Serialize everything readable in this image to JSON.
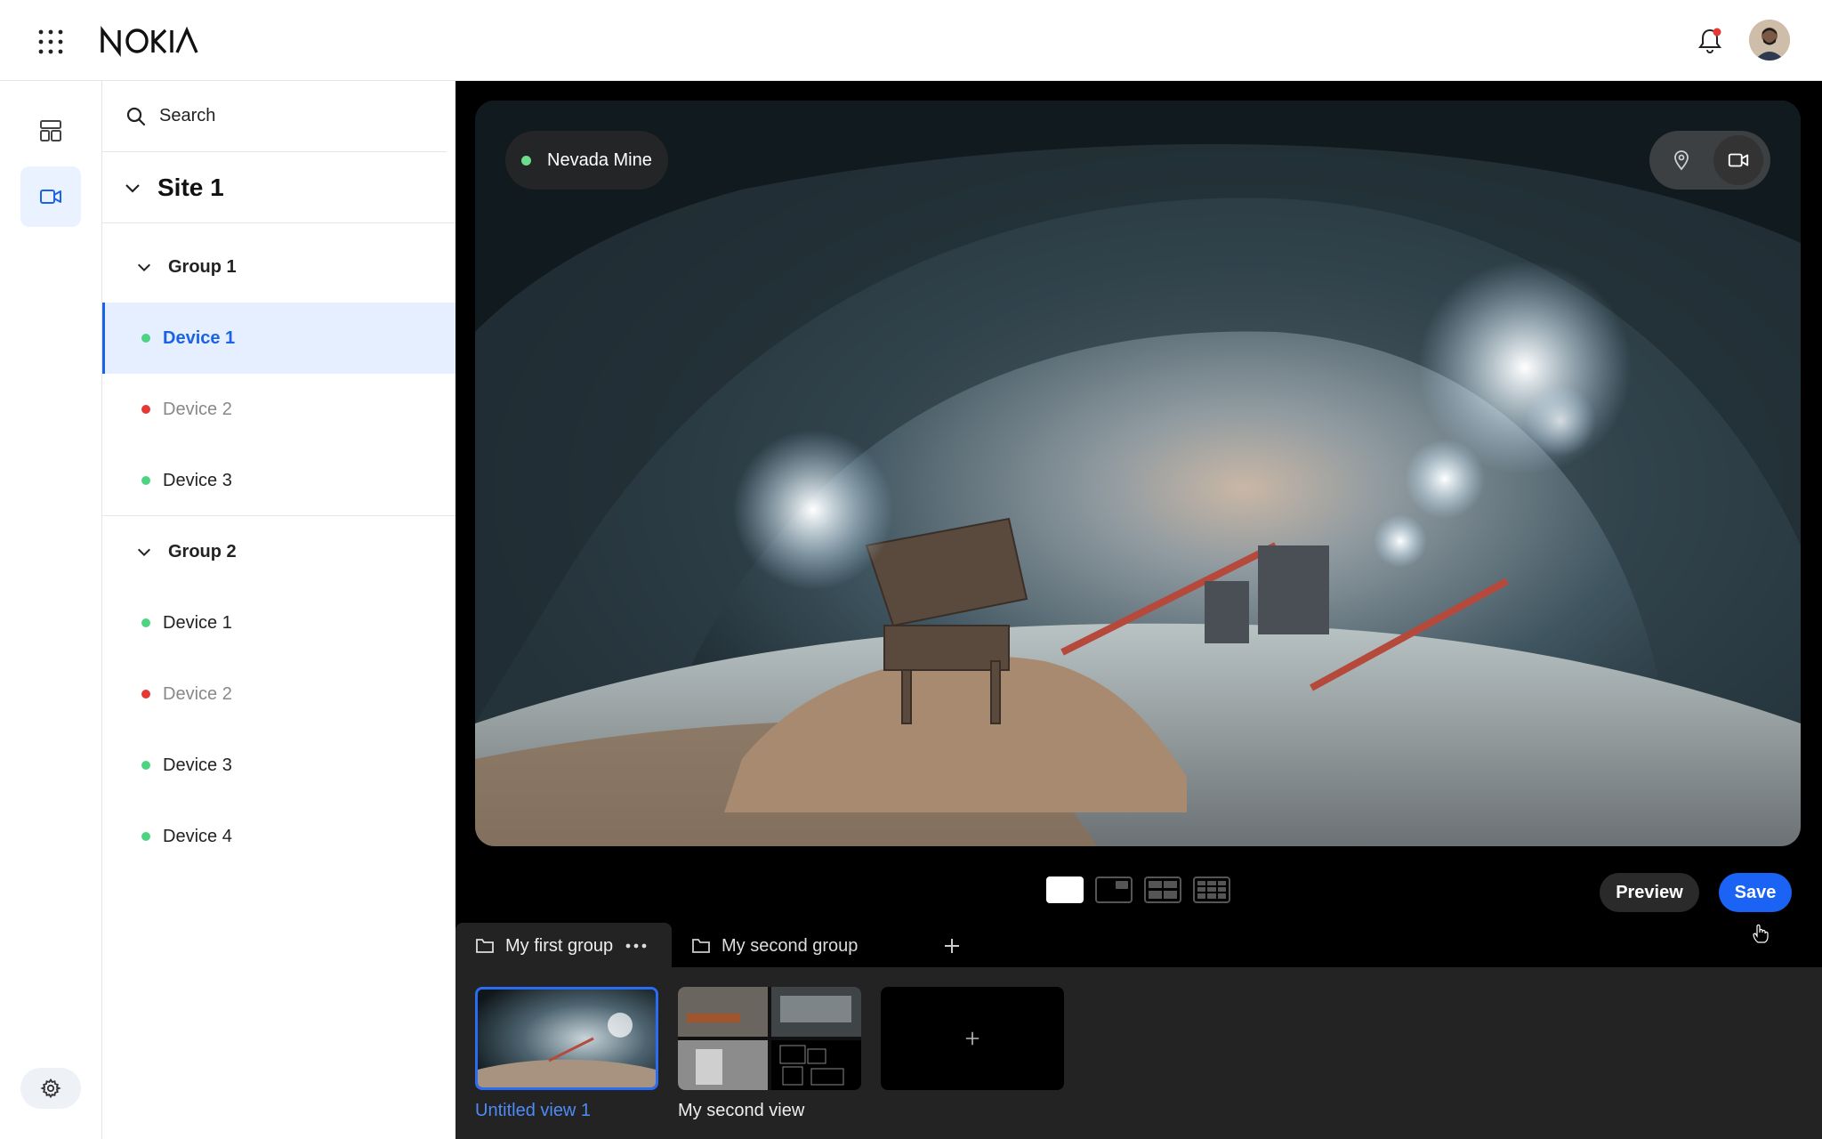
{
  "header": {
    "brand": "NOKIA",
    "apps_icon": "grid-dots-icon",
    "notification_icon": "bell-icon",
    "notification_badge_color": "#e53935",
    "avatar": "user-avatar"
  },
  "rail": {
    "items": [
      {
        "icon": "dashboard-icon",
        "active": false
      },
      {
        "icon": "video-camera-icon",
        "active": true
      }
    ],
    "settings_icon": "gear-icon"
  },
  "tree": {
    "search_placeholder": "Search",
    "site": {
      "label": "Site 1",
      "expanded": true
    },
    "groups": [
      {
        "label": "Group 1",
        "devices": [
          {
            "label": "Device 1",
            "status": "online",
            "selected": true
          },
          {
            "label": "Device 2",
            "status": "offline",
            "selected": false
          },
          {
            "label": "Device 3",
            "status": "online",
            "selected": false
          }
        ]
      },
      {
        "label": "Group 2",
        "devices": [
          {
            "label": "Device 1",
            "status": "online",
            "selected": false
          },
          {
            "label": "Device 2",
            "status": "offline",
            "selected": false
          },
          {
            "label": "Device 3",
            "status": "online",
            "selected": false
          },
          {
            "label": "Device 4",
            "status": "online",
            "selected": false
          }
        ]
      }
    ]
  },
  "viewer": {
    "location_label": "Nevada Mine",
    "location_status_color": "#6ddc8b",
    "view_toggle": [
      {
        "icon": "map-pin-icon",
        "active": false
      },
      {
        "icon": "video-camera-icon",
        "active": true
      }
    ],
    "layouts": [
      {
        "name": "single",
        "active": true
      },
      {
        "name": "picture-in-picture",
        "active": false
      },
      {
        "name": "2x2",
        "active": false
      },
      {
        "name": "3x2",
        "active": false
      }
    ],
    "preview_label": "Preview",
    "save_label": "Save"
  },
  "group_tabs": {
    "tabs": [
      {
        "label": "My first group",
        "active": true
      },
      {
        "label": "My second group",
        "active": false
      }
    ],
    "add_icon": "plus-icon"
  },
  "views": [
    {
      "label": "Untitled view 1",
      "selected": true
    },
    {
      "label": "My second view",
      "selected": false
    }
  ],
  "add_view_icon": "plus-icon",
  "colors": {
    "accent": "#1a63f5",
    "online": "#4cd483",
    "offline": "#e53935"
  }
}
